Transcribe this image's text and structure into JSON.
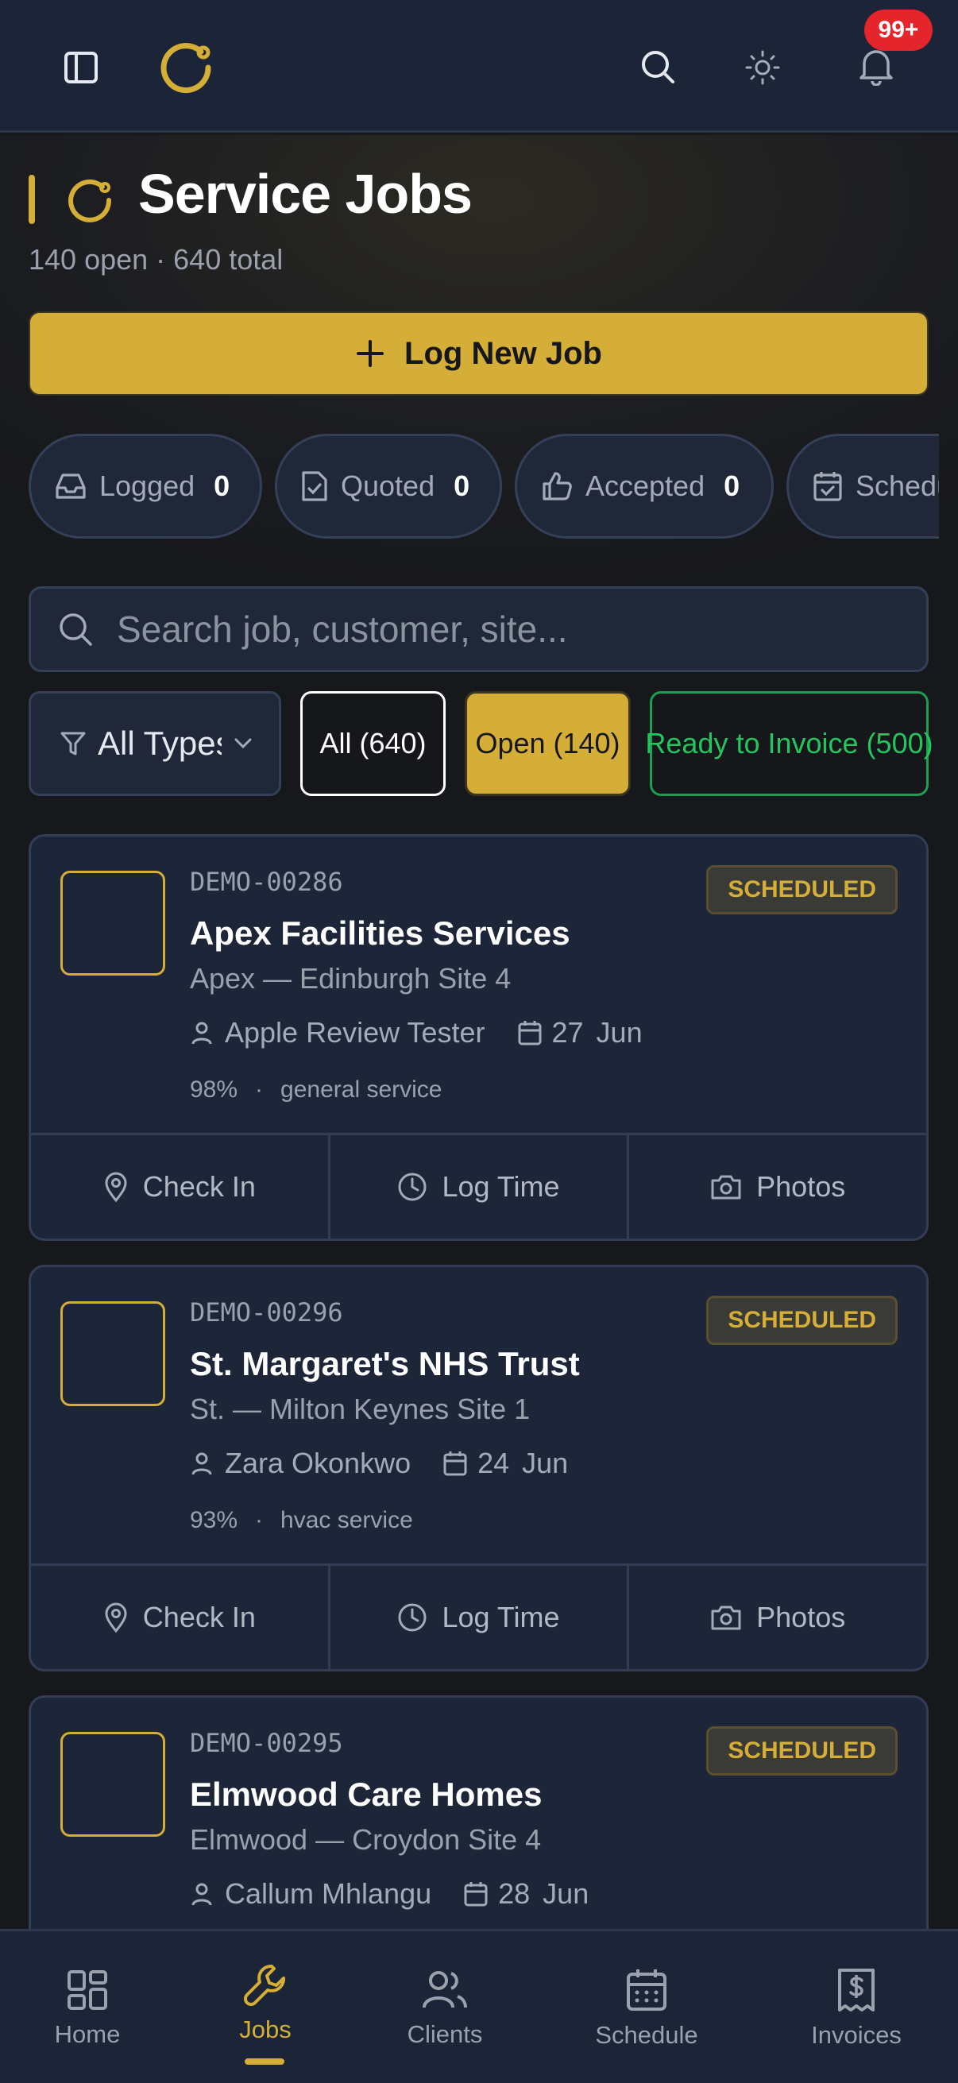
{
  "header": {
    "notification_badge": "99+"
  },
  "page": {
    "title": "Service Jobs",
    "subtitle": "140 open · 640 total",
    "primary_action": "Log New Job"
  },
  "status_chips": [
    {
      "label": "Logged",
      "count": "0",
      "icon": "inbox-icon"
    },
    {
      "label": "Quoted",
      "count": "0",
      "icon": "file-check-icon"
    },
    {
      "label": "Accepted",
      "count": "0",
      "icon": "thumbs-up-icon"
    },
    {
      "label": "Scheduled",
      "count": "",
      "icon": "calendar-check-icon"
    }
  ],
  "search": {
    "placeholder": "Search job, customer, site..."
  },
  "filters": {
    "type_select": "All Types",
    "segments": {
      "all": "All (640)",
      "open": "Open (140)",
      "ready": "Ready to Invoice (500)"
    }
  },
  "jobs": [
    {
      "code": "DEMO-00286",
      "status": "SCHEDULED",
      "customer": "Apex Facilities Services",
      "site": "Apex — Edinburgh Site 4",
      "assignee": "Apple Review Tester",
      "day": "27",
      "month": "Jun",
      "progress": "98%",
      "separator": "·",
      "service": "general service"
    },
    {
      "code": "DEMO-00296",
      "status": "SCHEDULED",
      "customer": "St. Margaret's NHS Trust",
      "site": "St. — Milton Keynes Site 1",
      "assignee": "Zara Okonkwo",
      "day": "24",
      "month": "Jun",
      "progress": "93%",
      "separator": "·",
      "service": "hvac service"
    },
    {
      "code": "DEMO-00295",
      "status": "SCHEDULED",
      "customer": "Elmwood Care Homes",
      "site": "Elmwood — Croydon Site 4",
      "assignee": "Callum Mhlangu",
      "day": "28",
      "month": "Jun",
      "progress": "",
      "separator": "",
      "service": ""
    }
  ],
  "card_actions": {
    "check_in": "Check In",
    "log_time": "Log Time",
    "photos": "Photos"
  },
  "bottom_nav": [
    {
      "label": "Home",
      "icon": "home-grid-icon"
    },
    {
      "label": "Jobs",
      "icon": "wrench-icon",
      "active": true
    },
    {
      "label": "Clients",
      "icon": "users-icon"
    },
    {
      "label": "Schedule",
      "icon": "calendar-icon"
    },
    {
      "label": "Invoices",
      "icon": "receipt-icon"
    }
  ],
  "colors": {
    "accent": "#d4ae36",
    "background": "#17181c",
    "surface": "#1d2639",
    "success": "#22c55e",
    "danger": "#e5252c"
  }
}
